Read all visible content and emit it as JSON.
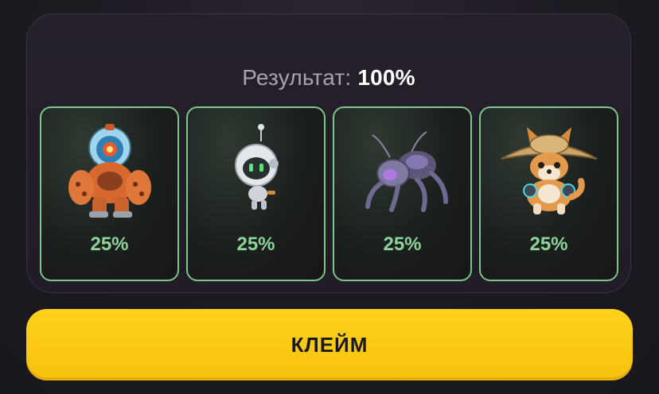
{
  "result": {
    "label": "Результат:",
    "value": "100%"
  },
  "cards": [
    {
      "icon": "robot-mech-icon",
      "percent": "25%"
    },
    {
      "icon": "drone-bot-icon",
      "percent": "25%"
    },
    {
      "icon": "spider-bot-icon",
      "percent": "25%"
    },
    {
      "icon": "shiba-dog-icon",
      "percent": "25%"
    }
  ],
  "claim_button": {
    "label": "КЛЕЙМ"
  },
  "colors": {
    "accent_green": "#7ec68b",
    "button_yellow": "#f7c10d"
  }
}
